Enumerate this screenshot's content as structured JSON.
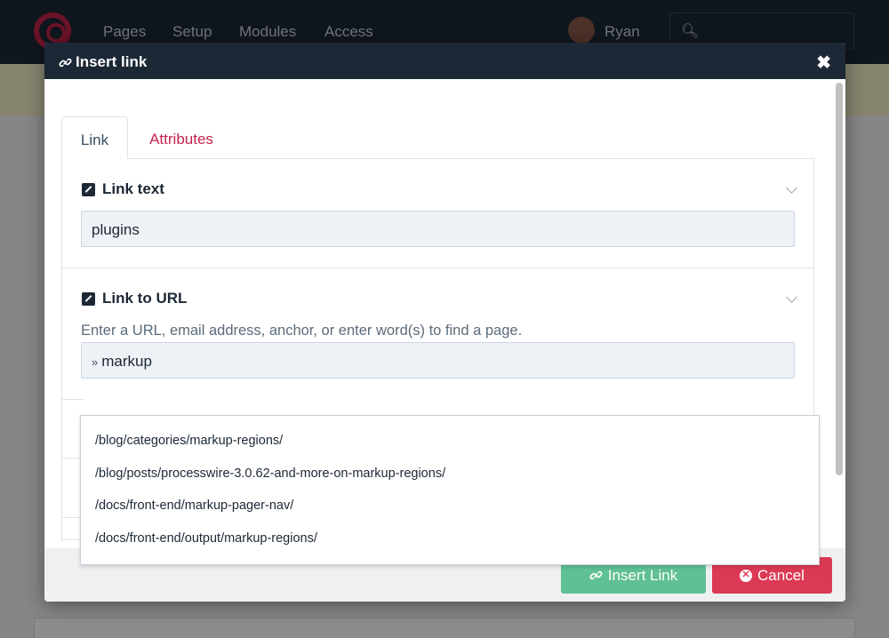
{
  "background": {
    "nav": [
      "Pages",
      "Setup",
      "Modules",
      "Access"
    ],
    "user_name": "Ryan",
    "search_icon": "search-icon"
  },
  "modal": {
    "title": "Insert link",
    "close_symbol": "✖",
    "tabs": [
      {
        "label": "Link",
        "active": true
      },
      {
        "label": "Attributes",
        "active": false
      }
    ],
    "link_text": {
      "label": "Link text",
      "value": "plugins"
    },
    "link_url": {
      "label": "Link to URL",
      "help": "Enter a URL, email address, anchor, or enter word(s) to find a page.",
      "value": "markup"
    },
    "suggestions": [
      "/blog/categories/markup-regions/",
      "/blog/posts/processwire-3.0.62-and-more-on-markup-regions/",
      "/docs/front-end/markup-pager-nav/",
      "/docs/front-end/output/markup-regions/"
    ],
    "buttons": {
      "insert": "Insert Link",
      "cancel": "Cancel"
    }
  },
  "colors": {
    "header": "#1c2836",
    "insert": "#5fbf95",
    "cancel": "#dc3a54",
    "accent": "#c4244a"
  }
}
